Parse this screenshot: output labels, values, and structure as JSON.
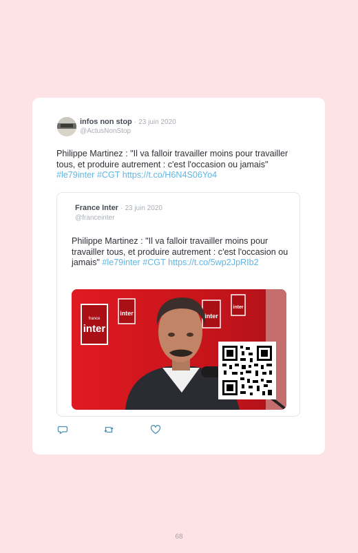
{
  "tweet": {
    "author_name": "infos non stop",
    "date": "23 juin 2020",
    "handle": "@ActusNonStop",
    "text": "Philippe Martinez : \"Il va falloir travailler moins pour travailler tous, et produire autrement : c'est l'occasion ou jamais\" ",
    "hashtag1": "#le79inter",
    "hashtag2": "#CGT",
    "link": "https://t.co/H6N4S06Yo4"
  },
  "quoted": {
    "author_name": "France Inter",
    "date": "23 juin 2020",
    "handle": "@franceinter",
    "text": "Philippe Martinez : \"Il va falloir travailler moins pour travailler tous, et produire autrement : c'est l'occasion ou jamais\" ",
    "hashtag1": "#le79inter",
    "hashtag2": "#CGT",
    "link": "https://t.co/5wp2JpRIb2",
    "logo_text": "inter",
    "logo_small": "france"
  },
  "separator": "·",
  "actions": {
    "reply_icon": "reply-icon",
    "retweet_icon": "retweet-icon",
    "like_icon": "heart-icon"
  },
  "colors": {
    "background": "#fde2e6",
    "card": "#ffffff",
    "link": "#5fb6e3",
    "brand_red": "#d7141c"
  },
  "page_number": "68"
}
